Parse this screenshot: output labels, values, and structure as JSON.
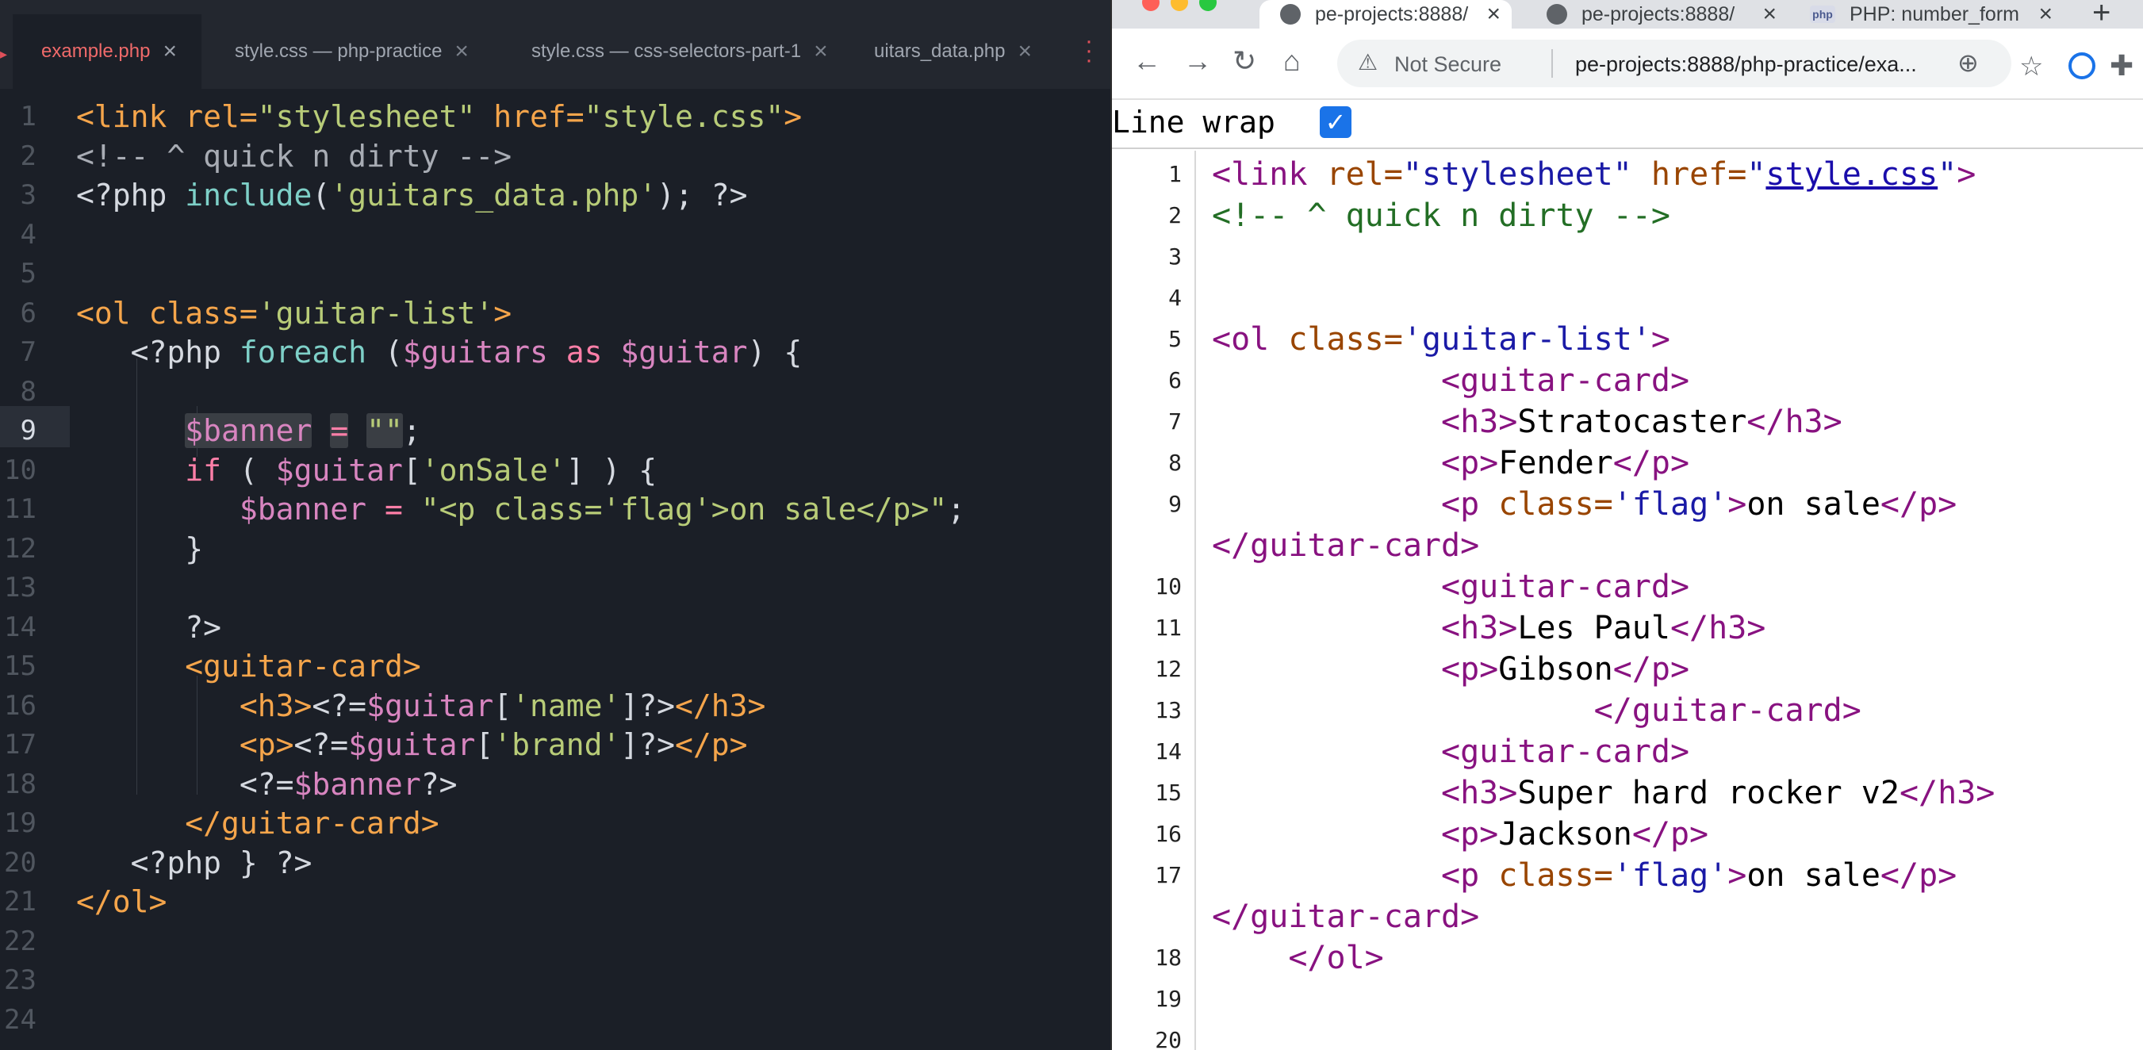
{
  "editor": {
    "tabs": [
      {
        "label": "example.php",
        "active": true
      },
      {
        "label": "style.css — php-practice",
        "active": false
      },
      {
        "label": "style.css — css-selectors-part-1",
        "active": false
      },
      {
        "label": "uitars_data.php",
        "active": false
      }
    ],
    "current_line": 9,
    "line_numbers": [
      "1",
      "2",
      "3",
      "4",
      "5",
      "6",
      "7",
      "8",
      "9",
      "10",
      "11",
      "12",
      "13",
      "14",
      "15",
      "16",
      "17",
      "18",
      "19",
      "20",
      "21",
      "22",
      "23",
      "24"
    ],
    "lines": [
      [
        [
          "tag",
          "<link "
        ],
        [
          "attr",
          "rel="
        ],
        [
          "str",
          "\"stylesheet\""
        ],
        [
          "plain",
          " "
        ],
        [
          "attr",
          "href="
        ],
        [
          "str",
          "\"style.css\""
        ],
        [
          "tag",
          ">"
        ]
      ],
      [
        [
          "com",
          "<!-- ^ quick n dirty -->"
        ]
      ],
      [
        [
          "plain",
          "<?php "
        ],
        [
          "fn",
          "include"
        ],
        [
          "plain",
          "("
        ],
        [
          "str",
          "'guitars_data.php'"
        ],
        [
          "plain",
          "); ?>"
        ]
      ],
      [],
      [],
      [
        [
          "tag",
          "<ol "
        ],
        [
          "attr",
          "class="
        ],
        [
          "str",
          "'guitar-list'"
        ],
        [
          "tag",
          ">"
        ]
      ],
      [
        [
          "plain",
          "   <?php "
        ],
        [
          "fn",
          "foreach"
        ],
        [
          "plain",
          " ("
        ],
        [
          "var",
          "$guitars"
        ],
        [
          "plain",
          " "
        ],
        [
          "kw",
          "as"
        ],
        [
          "plain",
          " "
        ],
        [
          "var",
          "$guitar"
        ],
        [
          "plain",
          ") {"
        ]
      ],
      [],
      [
        [
          "plain",
          "      "
        ],
        [
          "var",
          "$banner"
        ],
        [
          "plain",
          " "
        ],
        [
          "kw",
          "="
        ],
        [
          "plain",
          " "
        ],
        [
          "str",
          "\"\""
        ],
        [
          "plain",
          ";"
        ]
      ],
      [
        [
          "plain",
          "      "
        ],
        [
          "kw",
          "if"
        ],
        [
          "plain",
          " ( "
        ],
        [
          "var",
          "$guitar"
        ],
        [
          "plain",
          "["
        ],
        [
          "str",
          "'onSale'"
        ],
        [
          "plain",
          "] ) {"
        ]
      ],
      [
        [
          "plain",
          "         "
        ],
        [
          "var",
          "$banner"
        ],
        [
          "plain",
          " "
        ],
        [
          "kw",
          "="
        ],
        [
          "plain",
          " "
        ],
        [
          "str",
          "\"<p class='flag'>on sale</p>\""
        ],
        [
          "plain",
          ";"
        ]
      ],
      [
        [
          "plain",
          "      }"
        ]
      ],
      [],
      [
        [
          "plain",
          "      ?>"
        ]
      ],
      [
        [
          "plain",
          "      "
        ],
        [
          "tag",
          "<guitar-card>"
        ]
      ],
      [
        [
          "plain",
          "         "
        ],
        [
          "tag",
          "<h3>"
        ],
        [
          "plain",
          "<?="
        ],
        [
          "var",
          "$guitar"
        ],
        [
          "plain",
          "["
        ],
        [
          "str",
          "'name'"
        ],
        [
          "plain",
          "]?>"
        ],
        [
          "tag",
          "</h3>"
        ]
      ],
      [
        [
          "plain",
          "         "
        ],
        [
          "tag",
          "<p>"
        ],
        [
          "plain",
          "<?="
        ],
        [
          "var",
          "$guitar"
        ],
        [
          "plain",
          "["
        ],
        [
          "str",
          "'brand'"
        ],
        [
          "plain",
          "]?>"
        ],
        [
          "tag",
          "</p>"
        ]
      ],
      [
        [
          "plain",
          "         <?="
        ],
        [
          "var",
          "$banner"
        ],
        [
          "plain",
          "?>"
        ]
      ],
      [
        [
          "plain",
          "      "
        ],
        [
          "tag",
          "</guitar-card>"
        ]
      ],
      [
        [
          "plain",
          "   <?php } ?>"
        ]
      ],
      [
        [
          "tag",
          "</ol>"
        ]
      ],
      [],
      [],
      []
    ]
  },
  "browser": {
    "tabs": [
      {
        "label": "pe-projects:8888/",
        "icon": "globe-icon",
        "active": true
      },
      {
        "label": "pe-projects:8888/",
        "icon": "globe-icon",
        "active": false
      },
      {
        "label": "PHP: number_form",
        "icon": "php-icon",
        "active": false
      }
    ],
    "favicon_php_text": "php",
    "security_text": "Not Secure",
    "url": "pe-projects:8888/php-practice/exa...",
    "wrap_label": "Line wrap",
    "wrap_checked": true,
    "source_line_numbers": [
      {
        "n": "1",
        "row": 0
      },
      {
        "n": "2",
        "row": 1
      },
      {
        "n": "3",
        "row": 2
      },
      {
        "n": "4",
        "row": 3
      },
      {
        "n": "5",
        "row": 4
      },
      {
        "n": "6",
        "row": 5
      },
      {
        "n": "7",
        "row": 6
      },
      {
        "n": "8",
        "row": 7
      },
      {
        "n": "9",
        "row": 8
      },
      {
        "n": "10",
        "row": 10
      },
      {
        "n": "11",
        "row": 11
      },
      {
        "n": "12",
        "row": 12
      },
      {
        "n": "13",
        "row": 13
      },
      {
        "n": "14",
        "row": 14
      },
      {
        "n": "15",
        "row": 15
      },
      {
        "n": "16",
        "row": 16
      },
      {
        "n": "17",
        "row": 17
      },
      {
        "n": "18",
        "row": 19
      },
      {
        "n": "19",
        "row": 20
      },
      {
        "n": "20",
        "row": 21
      }
    ],
    "source_rows": [
      [
        [
          "tag",
          "<link "
        ],
        [
          "attr",
          "rel="
        ],
        [
          "val",
          "\"stylesheet\""
        ],
        [
          "text",
          " "
        ],
        [
          "attr",
          "href="
        ],
        [
          "val",
          "\""
        ],
        [
          "link",
          "style.css"
        ],
        [
          "val",
          "\""
        ],
        [
          "tag",
          ">"
        ]
      ],
      [
        [
          "com",
          "<!-- ^ quick n dirty -->"
        ]
      ],
      [],
      [],
      [
        [
          "tag",
          "<ol "
        ],
        [
          "attr",
          "class="
        ],
        [
          "val",
          "'guitar-list'"
        ],
        [
          "tag",
          ">"
        ]
      ],
      [
        [
          "text",
          "            "
        ],
        [
          "tag",
          "<guitar-card>"
        ]
      ],
      [
        [
          "text",
          "            "
        ],
        [
          "tag",
          "<h3>"
        ],
        [
          "text",
          "Stratocaster"
        ],
        [
          "tag",
          "</h3>"
        ]
      ],
      [
        [
          "text",
          "            "
        ],
        [
          "tag",
          "<p>"
        ],
        [
          "text",
          "Fender"
        ],
        [
          "tag",
          "</p>"
        ]
      ],
      [
        [
          "text",
          "            "
        ],
        [
          "tag",
          "<p "
        ],
        [
          "attr",
          "class="
        ],
        [
          "val",
          "'flag'"
        ],
        [
          "tag",
          ">"
        ],
        [
          "text",
          "on sale"
        ],
        [
          "tag",
          "</p>"
        ]
      ],
      [
        [
          "tag",
          "</guitar-card>"
        ]
      ],
      [
        [
          "text",
          "            "
        ],
        [
          "tag",
          "<guitar-card>"
        ]
      ],
      [
        [
          "text",
          "            "
        ],
        [
          "tag",
          "<h3>"
        ],
        [
          "text",
          "Les Paul"
        ],
        [
          "tag",
          "</h3>"
        ]
      ],
      [
        [
          "text",
          "            "
        ],
        [
          "tag",
          "<p>"
        ],
        [
          "text",
          "Gibson"
        ],
        [
          "tag",
          "</p>"
        ]
      ],
      [
        [
          "text",
          "                    "
        ],
        [
          "tag",
          "</guitar-card>"
        ]
      ],
      [
        [
          "text",
          "            "
        ],
        [
          "tag",
          "<guitar-card>"
        ]
      ],
      [
        [
          "text",
          "            "
        ],
        [
          "tag",
          "<h3>"
        ],
        [
          "text",
          "Super hard rocker v2"
        ],
        [
          "tag",
          "</h3>"
        ]
      ],
      [
        [
          "text",
          "            "
        ],
        [
          "tag",
          "<p>"
        ],
        [
          "text",
          "Jackson"
        ],
        [
          "tag",
          "</p>"
        ]
      ],
      [
        [
          "text",
          "            "
        ],
        [
          "tag",
          "<p "
        ],
        [
          "attr",
          "class="
        ],
        [
          "val",
          "'flag'"
        ],
        [
          "tag",
          ">"
        ],
        [
          "text",
          "on sale"
        ],
        [
          "tag",
          "</p>"
        ]
      ],
      [
        [
          "tag",
          "</guitar-card>"
        ]
      ],
      [
        [
          "text",
          "    "
        ],
        [
          "tag",
          "</ol>"
        ]
      ],
      [],
      []
    ]
  }
}
